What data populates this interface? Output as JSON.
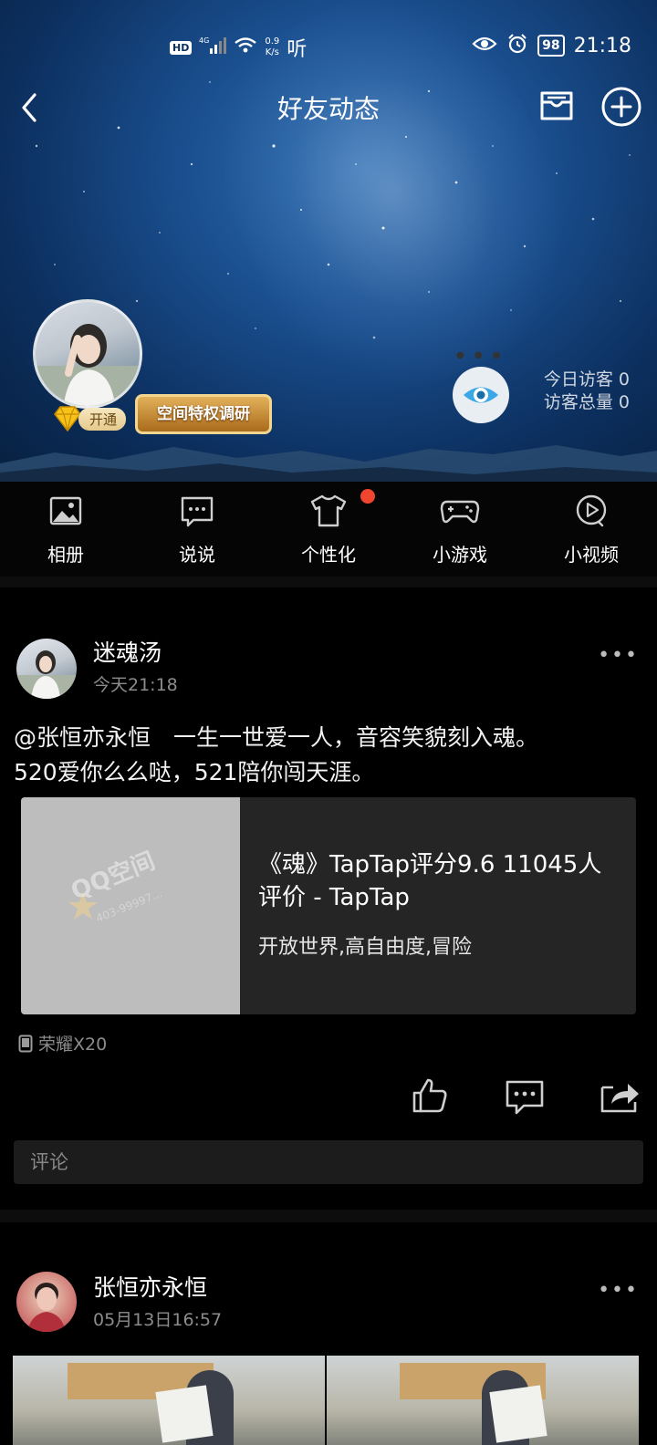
{
  "status_bar": {
    "hd": "HD",
    "network": "4G",
    "speed_value": "0.9",
    "speed_unit": "K/s",
    "listen": "听",
    "battery": "98",
    "time": "21:18"
  },
  "nav": {
    "title": "好友动态"
  },
  "header": {
    "vip_label": "开通",
    "privilege_banner": "空间特权调研",
    "visitors_today": "今日访客 0",
    "visitors_total": "访客总量 0"
  },
  "quickbar": {
    "items": [
      {
        "label": "相册",
        "icon": "album-icon"
      },
      {
        "label": "说说",
        "icon": "shuoshuo-icon"
      },
      {
        "label": "个性化",
        "icon": "shirt-icon"
      },
      {
        "label": "小游戏",
        "icon": "gamepad-icon"
      },
      {
        "label": "小视频",
        "icon": "video-icon"
      }
    ]
  },
  "feed": [
    {
      "user": "迷魂汤",
      "time": "今天21:18",
      "text_line1": "@张恒亦永恒　一生一世爱一人，音容笑貌刻入魂。",
      "text_line2": "520爱你么么哒，521陪你闯天涯。",
      "link_card": {
        "title": "《魂》TapTap评分9.6 11045人评价 - TapTap",
        "description": "开放世界,高自由度,冒险",
        "watermark": "QQ空间",
        "watermark_sub": "403-99997..."
      },
      "device": "荣耀X20",
      "comment_placeholder": "评论"
    },
    {
      "user": "张恒亦永恒",
      "time": "05月13日16:57"
    }
  ],
  "colors": {
    "background": "#000000",
    "notification_dot": "#f0452e",
    "muted_text": "#8c8c8c"
  }
}
